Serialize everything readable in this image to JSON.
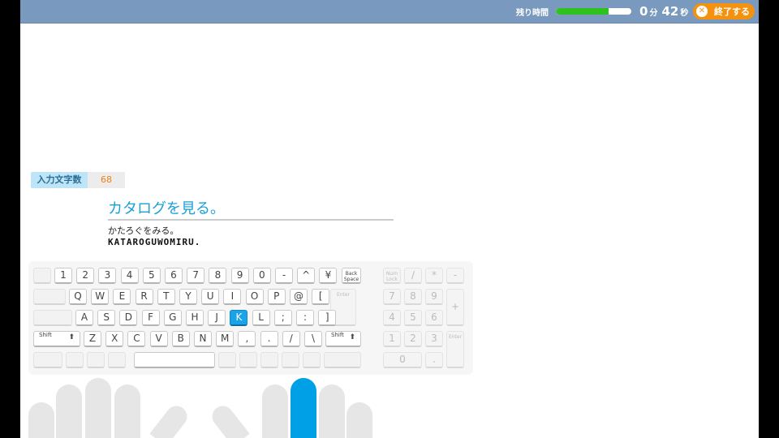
{
  "header": {
    "timer_label": "残り時間",
    "timer_progress": 0.7,
    "minutes": "0",
    "minutes_unit": "分",
    "seconds": "42",
    "seconds_unit": "秒",
    "end_label": "終了する",
    "end_icon_glyph": "✕"
  },
  "stats": {
    "count_label": "入力文字数",
    "count_value": "68"
  },
  "prompt": {
    "target": "カタログを見る。",
    "reading": "かたろぐをみる。",
    "romaji": "KATAROGUWOMIRU."
  },
  "keyboard": {
    "active_key": "K",
    "colors": {
      "active": "#1aa3e8",
      "accent": "#f4920f",
      "progress": "#2fc11d"
    },
    "row1": [
      "1",
      "2",
      "3",
      "4",
      "5",
      "6",
      "7",
      "8",
      "9",
      "0",
      "-",
      "^",
      "¥"
    ],
    "backspace": "Back\nSpace",
    "row2": [
      "Q",
      "W",
      "E",
      "R",
      "T",
      "Y",
      "U",
      "I",
      "O",
      "P",
      "@",
      "["
    ],
    "enter": "Enter",
    "row3": [
      "A",
      "S",
      "D",
      "F",
      "G",
      "H",
      "J",
      "K",
      "L",
      ";",
      ":",
      "]"
    ],
    "shift": "Shift",
    "shift_icon": "⬆",
    "row4": [
      "Z",
      "X",
      "C",
      "V",
      "B",
      "N",
      "M",
      ",",
      ".",
      "/",
      "\\"
    ],
    "numpad": {
      "numlock": "Num\nLock",
      "row1": [
        "/",
        "*",
        "-"
      ],
      "row2": [
        "7",
        "8",
        "9"
      ],
      "plus": "+",
      "row3": [
        "4",
        "5",
        "6"
      ],
      "row4": [
        "1",
        "2",
        "3"
      ],
      "zero": "0",
      "dot": ".",
      "enter": "Enter"
    }
  },
  "hands": {
    "active_finger": "right-middle"
  }
}
